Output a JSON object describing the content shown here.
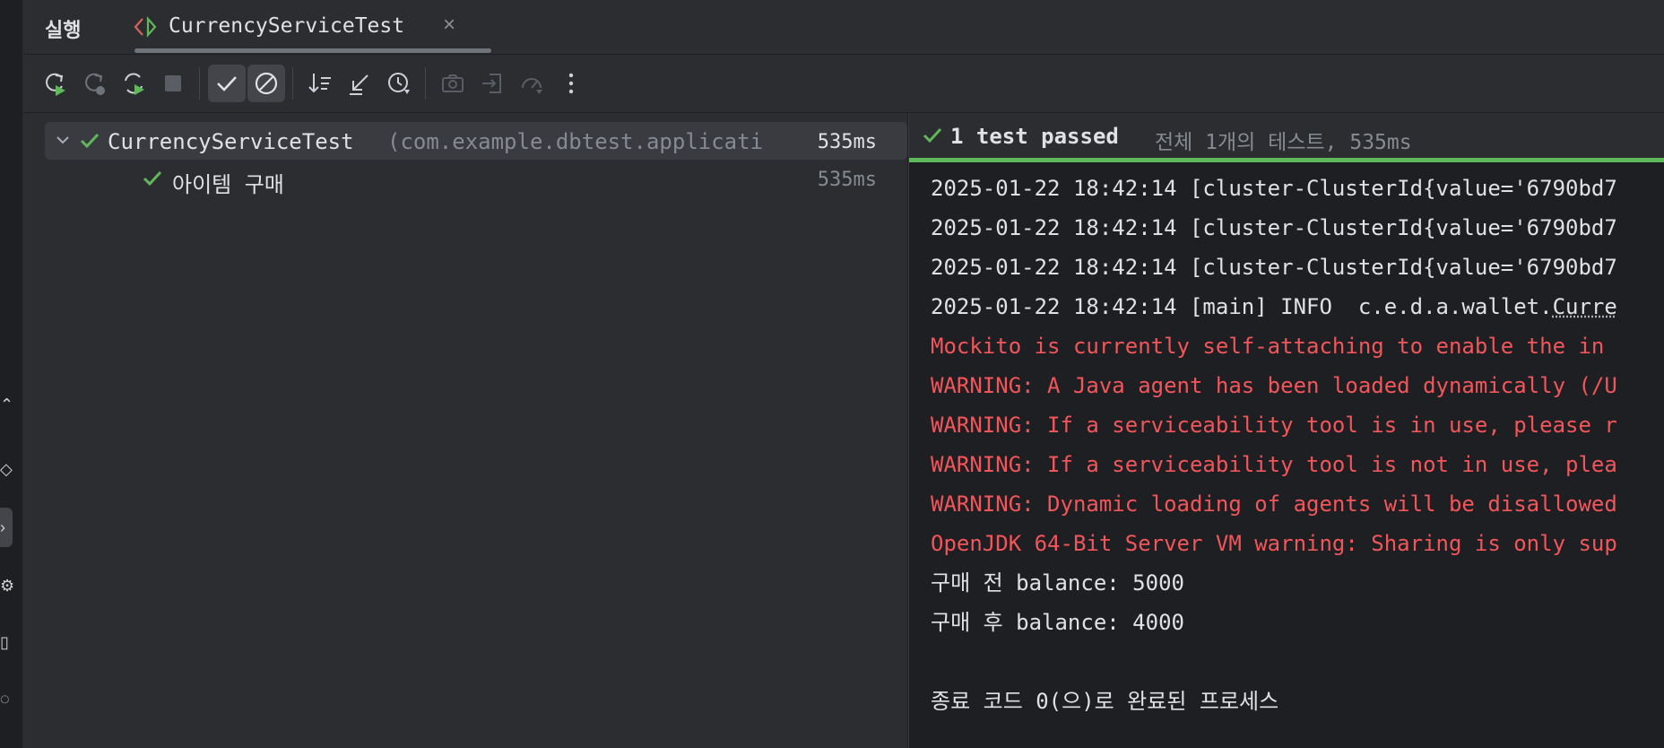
{
  "header": {
    "run_label": "실행",
    "tab_title": "CurrencyServiceTest",
    "close_glyph": "×"
  },
  "toolbar": {
    "buttons": [
      {
        "name": "rerun-icon"
      },
      {
        "name": "rerun-failed-icon"
      },
      {
        "name": "toggle-auto-test-icon"
      },
      {
        "name": "stop-icon"
      },
      {
        "name": "show-passed-icon",
        "toggled": true
      },
      {
        "name": "show-ignored-icon",
        "toggled": true
      },
      {
        "name": "sort-icon"
      },
      {
        "name": "collapse-all-icon"
      },
      {
        "name": "test-history-icon"
      },
      {
        "name": "screenshot-icon"
      },
      {
        "name": "import-tests-icon"
      },
      {
        "name": "coverage-icon"
      },
      {
        "name": "more-options-icon"
      }
    ]
  },
  "tree": {
    "root": {
      "name": "CurrencyServiceTest",
      "package": "(com.example.dbtest.applicati",
      "duration": "535ms"
    },
    "child": {
      "name": "아이템 구매",
      "duration": "535ms"
    }
  },
  "console": {
    "status_main": "1 test passed",
    "status_sub": "전체 1개의 테스트, 535ms",
    "lines": [
      {
        "text": "2025-01-22 18:42:14 [cluster-ClusterId{value='6790bd7",
        "type": "normal"
      },
      {
        "text": "2025-01-22 18:42:14 [cluster-ClusterId{value='6790bd7",
        "type": "normal"
      },
      {
        "text": "2025-01-22 18:42:14 [cluster-ClusterId{value='6790bd7",
        "type": "normal"
      },
      {
        "text": "2025-01-22 18:42:14 [main] INFO  c.e.d.a.wallet.",
        "tail": "Curre",
        "type": "normal"
      },
      {
        "text": "Mockito is currently self-attaching to enable the in",
        "type": "error"
      },
      {
        "text": "WARNING: A Java agent has been loaded dynamically (/U",
        "type": "error"
      },
      {
        "text": "WARNING: If a serviceability tool is in use, please r",
        "type": "error"
      },
      {
        "text": "WARNING: If a serviceability tool is not in use, plea",
        "type": "error"
      },
      {
        "text": "WARNING: Dynamic loading of agents will be disallowed",
        "type": "error"
      },
      {
        "text": "OpenJDK 64-Bit Server VM warning: Sharing is only sup",
        "type": "error"
      },
      {
        "text": "구매 전 balance: 5000",
        "type": "normal"
      },
      {
        "text": "구매 후 balance: 4000",
        "type": "normal"
      },
      {
        "text": "",
        "type": "normal"
      },
      {
        "text": "종료 코드 0(으)로 완료된 프로세스",
        "type": "normal"
      }
    ]
  },
  "colors": {
    "pass_green": "#5fb85a",
    "error_red": "#f2555a",
    "panel_bg": "#2b2d30",
    "console_bg": "#1e1f22"
  }
}
